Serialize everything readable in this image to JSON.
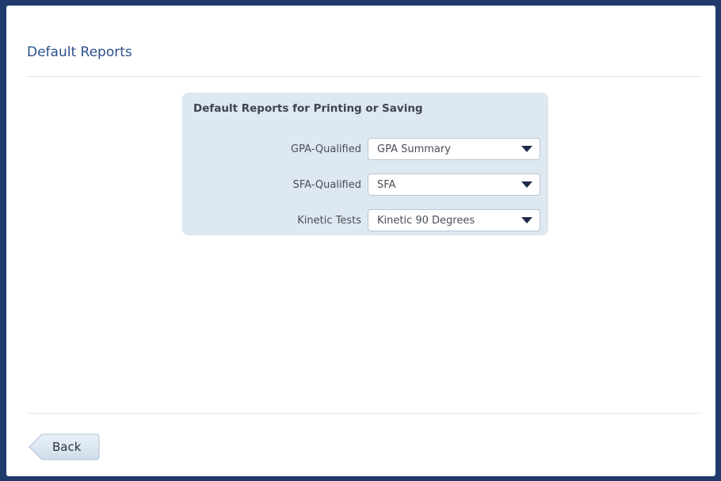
{
  "header": {
    "title": "Default Reports"
  },
  "panel": {
    "title": "Default Reports for Printing or Saving",
    "rows": [
      {
        "label": "GPA-Qualified",
        "value": "GPA Summary"
      },
      {
        "label": "SFA-Qualified",
        "value": "SFA"
      },
      {
        "label": "Kinetic Tests",
        "value": "Kinetic 90 Degrees"
      }
    ]
  },
  "footer": {
    "back_label": "Back"
  },
  "colors": {
    "frame": "#1f3a6b",
    "title": "#2b4f8c",
    "panel_bg": "#dde8f1",
    "caret": "#1e2a4a"
  },
  "icons": {
    "dropdown": "caret-down-icon",
    "back": "arrow-left-icon"
  }
}
